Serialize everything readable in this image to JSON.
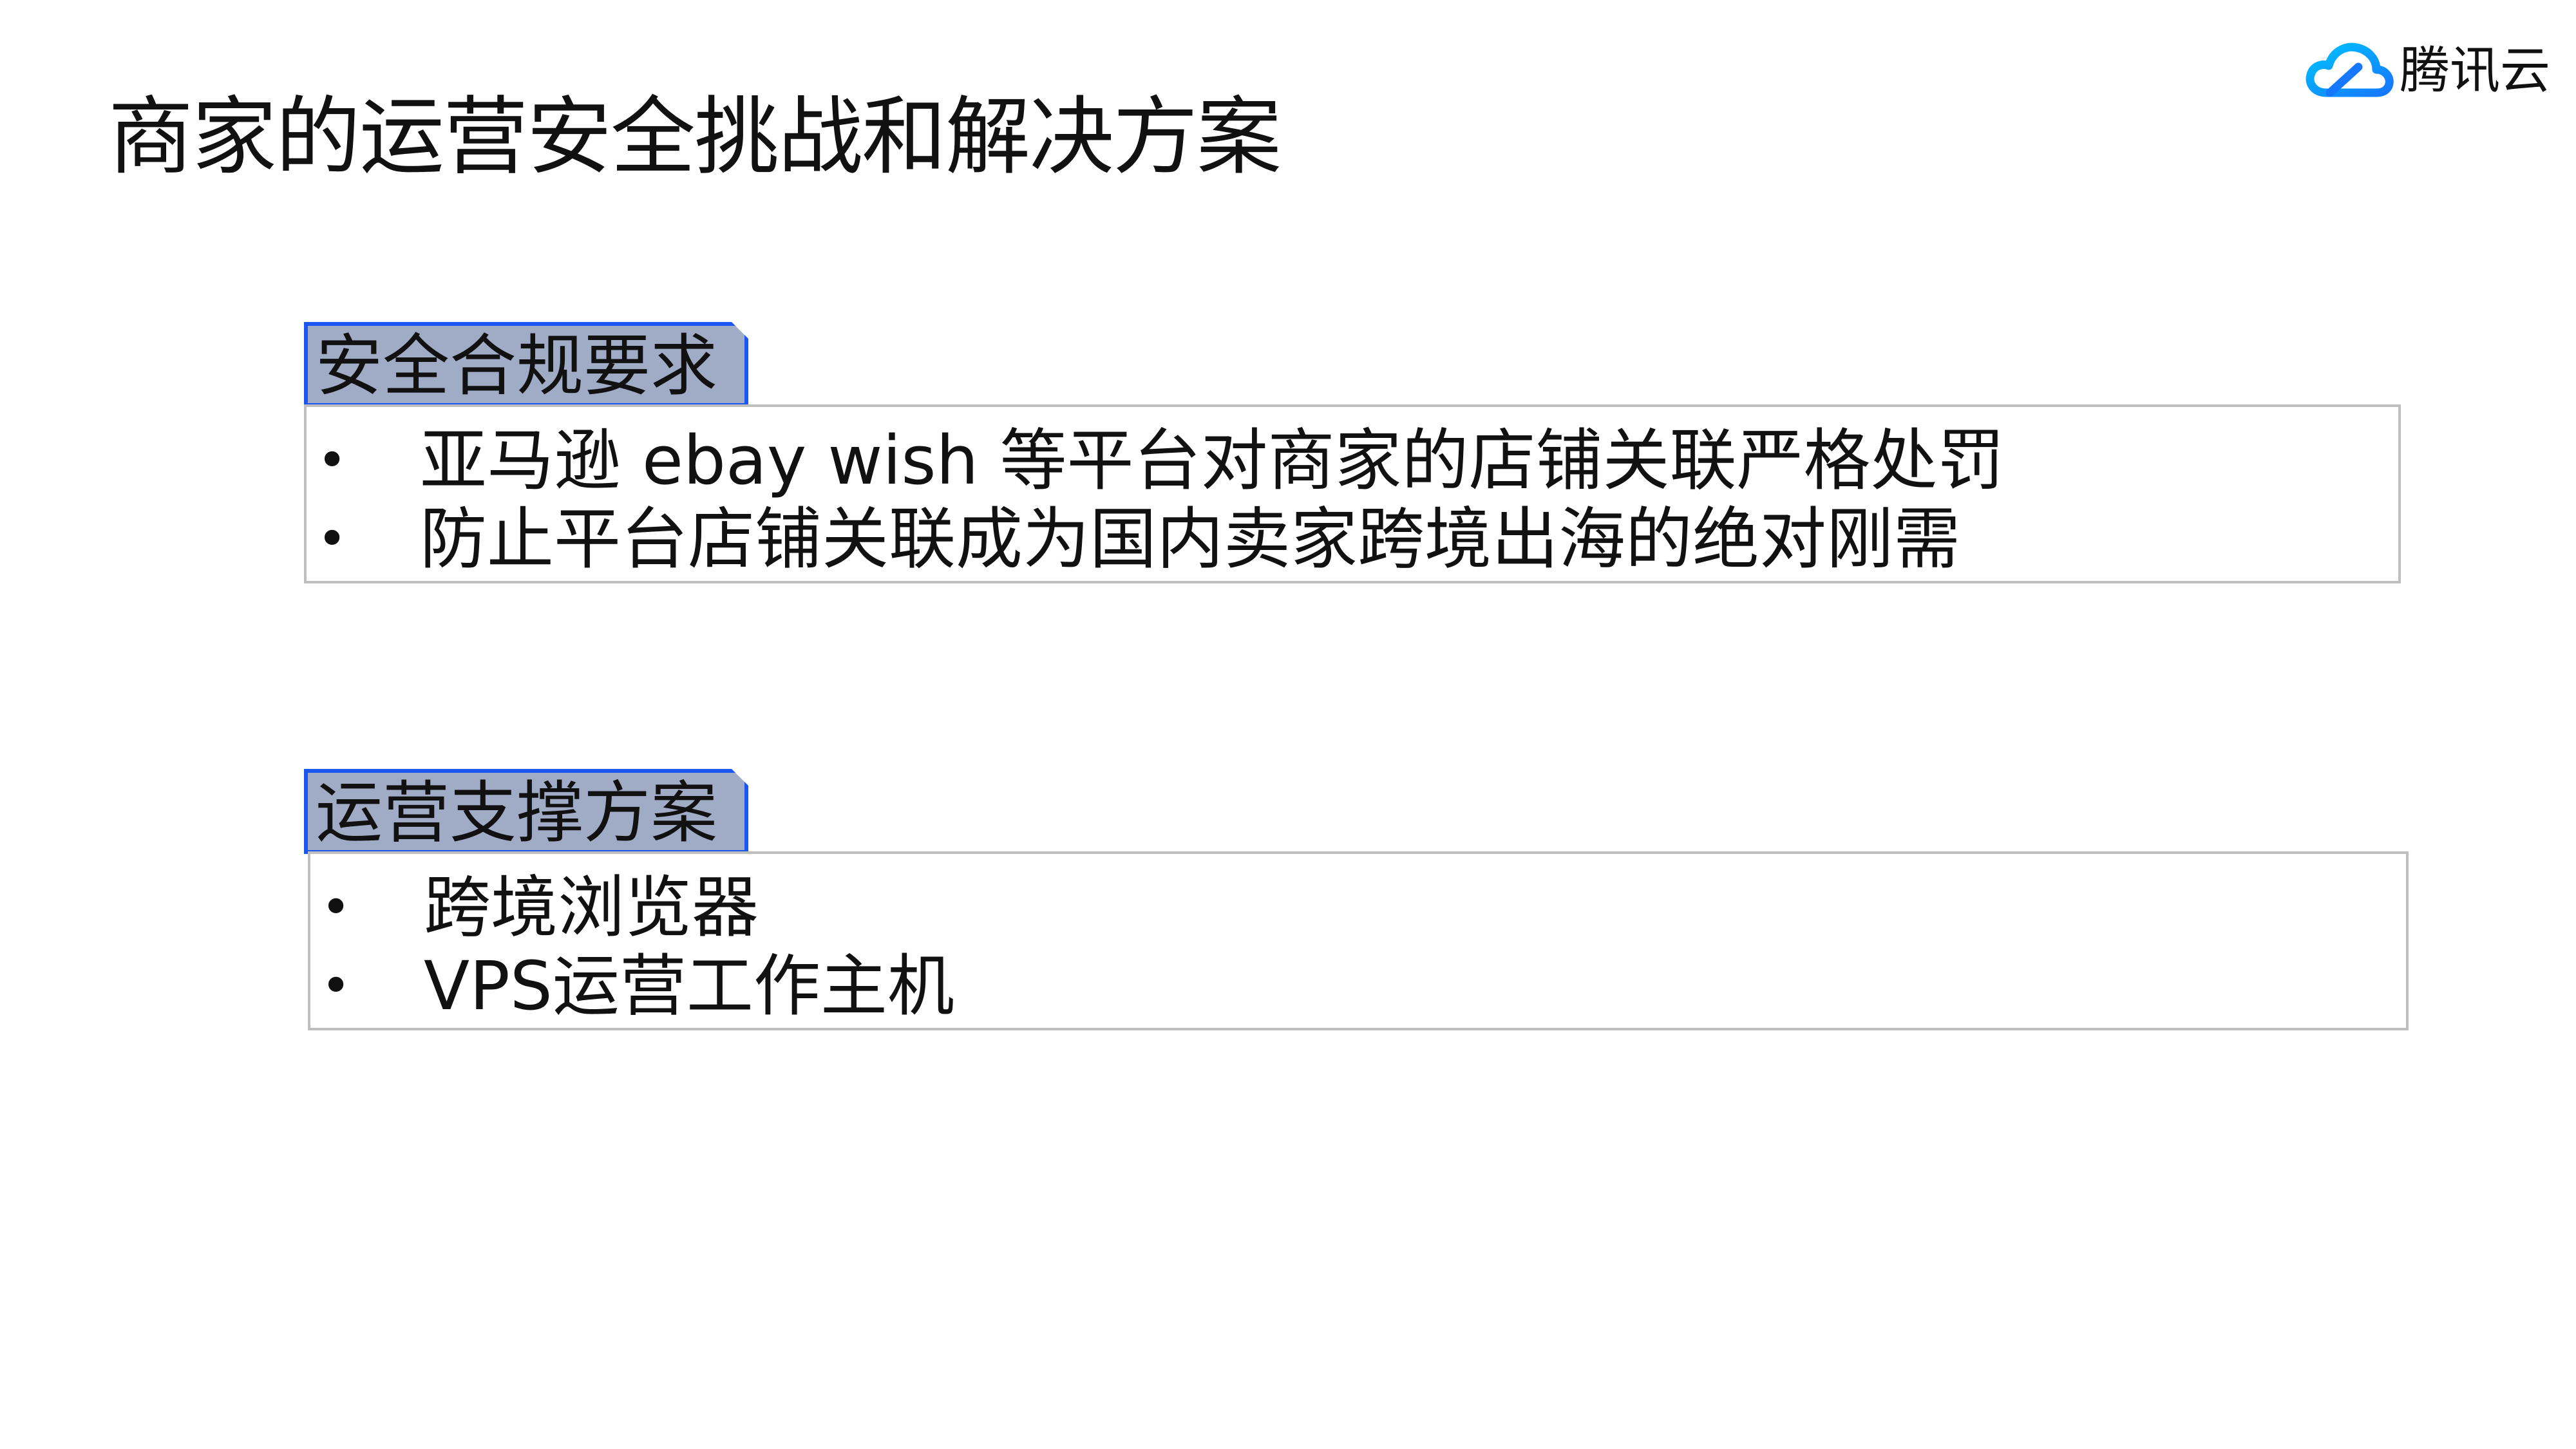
{
  "title": "商家的运营安全挑战和解决方案",
  "logo": {
    "text": "腾讯云",
    "icon": "tencent-cloud-icon",
    "colors": [
      "#00a3ff",
      "#1677ff"
    ]
  },
  "sections": [
    {
      "label": "安全合规要求",
      "items": [
        "亚马逊 ebay wish 等平台对商家的店铺关联严格处罚",
        "防止平台店铺关联成为国内卖家跨境出海的绝对刚需"
      ]
    },
    {
      "label": "运营支撑方案",
      "items": [
        "跨境浏览器",
        "VPS运营工作主机"
      ]
    }
  ],
  "bullet_glyph": "•",
  "colors": {
    "tab_fill": "#a0abc5",
    "tab_border": "#1a56ef",
    "box_border": "#bfbfbf"
  }
}
